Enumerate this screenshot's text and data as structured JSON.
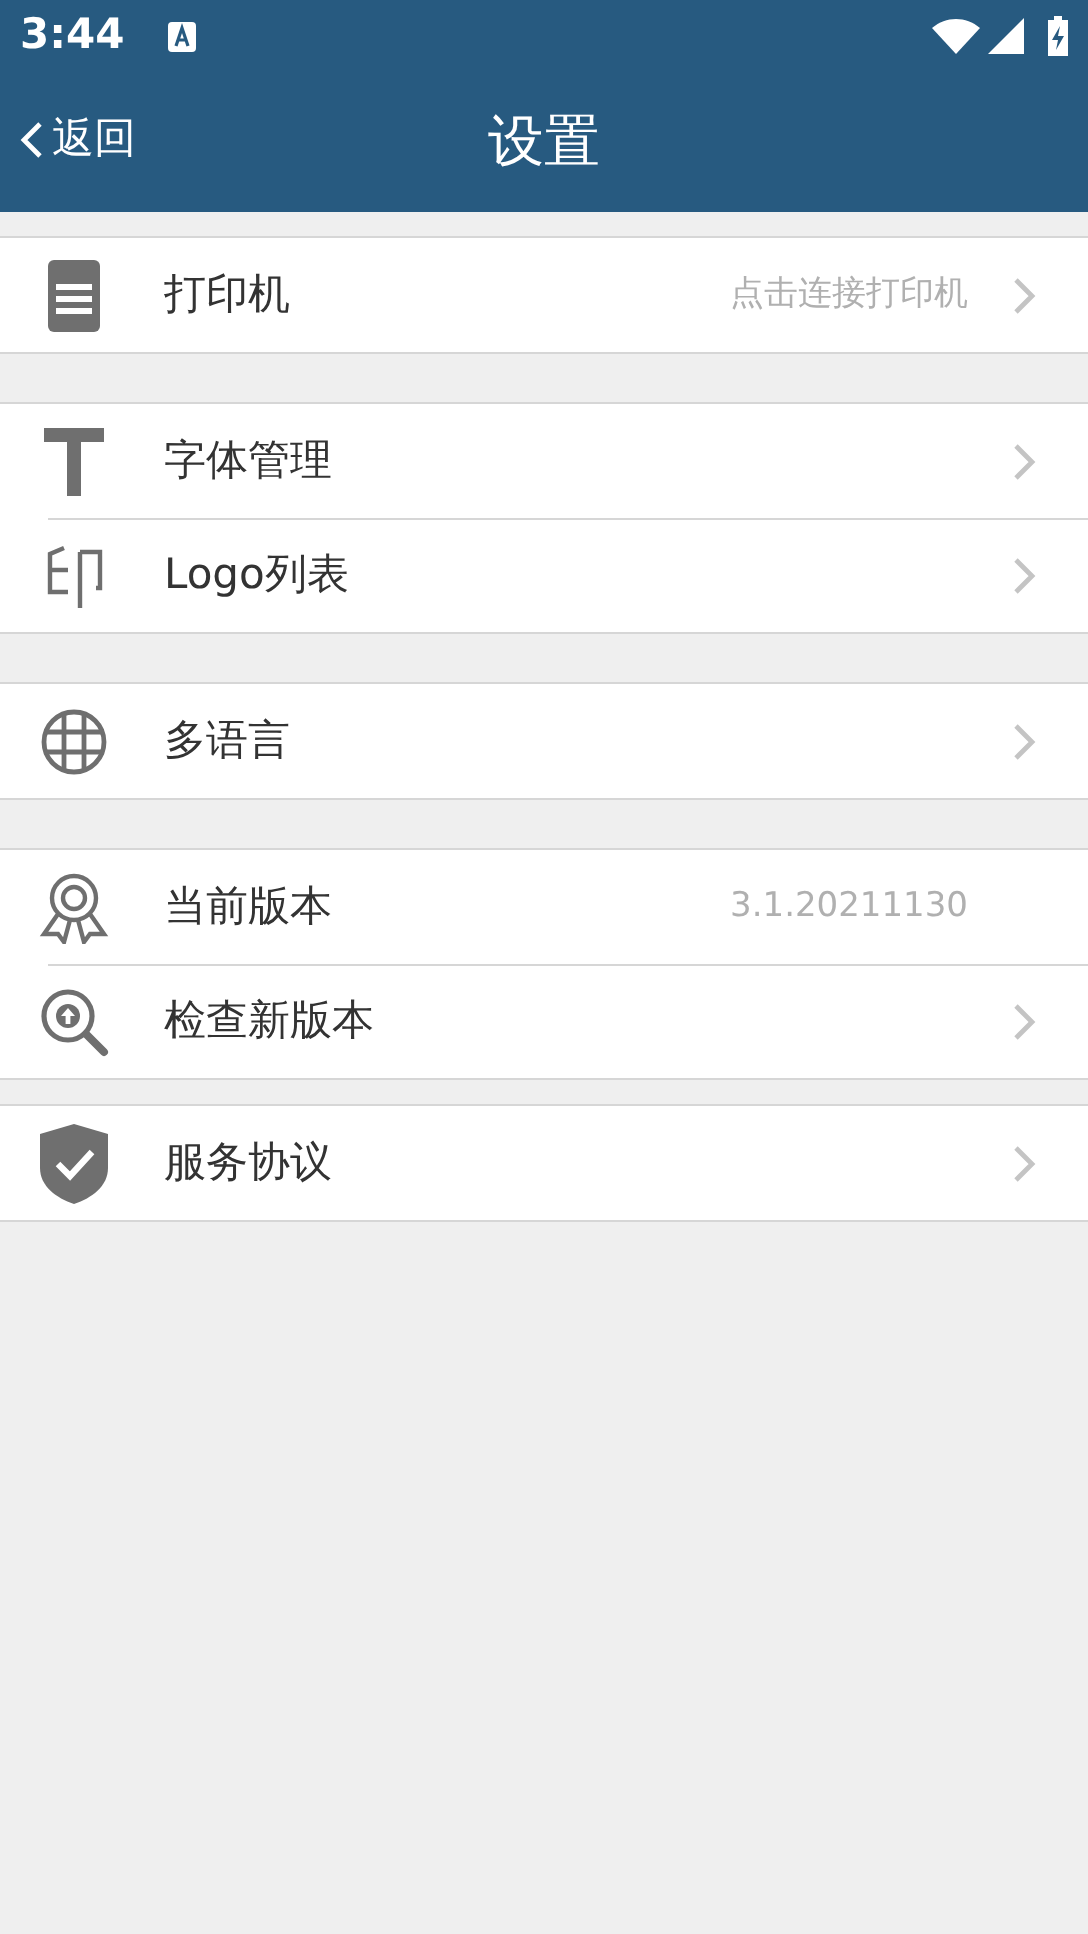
{
  "status_bar": {
    "time": "3:44"
  },
  "header": {
    "back": "返回",
    "title": "设置"
  },
  "groups": [
    {
      "rows": [
        {
          "label": "打印机",
          "value": "点击连接打印机",
          "chevron": true
        }
      ]
    },
    {
      "rows": [
        {
          "label": "字体管理",
          "chevron": true
        },
        {
          "label": "Logo列表",
          "chevron": true
        }
      ]
    },
    {
      "rows": [
        {
          "label": "多语言",
          "chevron": true
        }
      ]
    },
    {
      "rows": [
        {
          "label": "当前版本",
          "value": "3.1.20211130",
          "chevron": false
        },
        {
          "label": "检查新版本",
          "chevron": true
        }
      ]
    },
    {
      "rows": [
        {
          "label": "服务协议",
          "chevron": true
        }
      ]
    }
  ]
}
